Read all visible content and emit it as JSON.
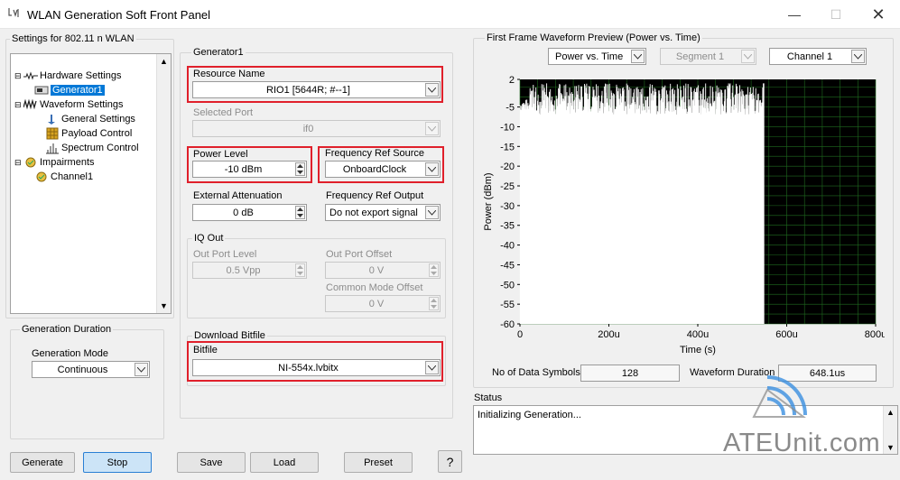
{
  "window": {
    "title": "WLAN Generation Soft Front Panel"
  },
  "settings_group": {
    "label": "Settings for 802.11 n WLAN"
  },
  "tree": {
    "hardware_settings": "Hardware Settings",
    "generator1": "Generator1",
    "waveform_settings": "Waveform Settings",
    "general_settings": "General Settings",
    "payload_control": "Payload Control",
    "spectrum_control": "Spectrum Control",
    "impairments": "Impairments",
    "channel1": "Channel1"
  },
  "generation_duration": {
    "label": "Generation Duration",
    "mode_label": "Generation Mode",
    "mode_value": "Continuous"
  },
  "generator1": {
    "label": "Generator1",
    "resource_name_label": "Resource Name",
    "resource_name_value": "RIO1 [5644R; #--1]",
    "selected_port_label": "Selected Port",
    "selected_port_value": "if0",
    "power_level_label": "Power Level",
    "power_level_value": "-10 dBm",
    "freq_ref_source_label": "Frequency Ref Source",
    "freq_ref_source_value": "OnboardClock",
    "ext_atten_label": "External Attenuation",
    "ext_atten_value": "0 dB",
    "freq_ref_output_label": "Frequency Ref Output",
    "freq_ref_output_value": "Do not export signal"
  },
  "iq_out": {
    "label": "IQ Out",
    "out_port_level_label": "Out Port Level",
    "out_port_level_value": "0.5 Vpp",
    "out_port_offset_label": "Out Port Offset",
    "out_port_offset_value": "0 V",
    "common_mode_offset_label": "Common Mode Offset",
    "common_mode_offset_value": "0 V"
  },
  "download_bitfile": {
    "label": "Download Bitfile",
    "bitfile_label": "Bitfile",
    "bitfile_value": "NI-554x.lvbitx"
  },
  "preview": {
    "label": "First Frame Waveform Preview (Power vs. Time)",
    "view_select": "Power vs. Time",
    "segment_select": "Segment 1",
    "channel_select": "Channel 1",
    "num_data_symbols_label": "No of Data Symbols",
    "num_data_symbols_value": "128",
    "waveform_duration_label": "Waveform Duration",
    "waveform_duration_value": "648.1us"
  },
  "status": {
    "label": "Status",
    "text": "Initializing Generation..."
  },
  "buttons": {
    "generate": "Generate",
    "stop": "Stop",
    "save": "Save",
    "load": "Load",
    "preset": "Preset",
    "help": "?"
  },
  "watermark": "ATEUnit.com",
  "chart_data": {
    "type": "line",
    "xlabel": "Time (s)",
    "ylabel": "Power (dBm)",
    "xlim": [
      0,
      800
    ],
    "ylim": [
      -60,
      2
    ],
    "x_ticks": [
      "0",
      "200u",
      "400u",
      "600u",
      "800u"
    ],
    "y_ticks": [
      "2",
      "-5",
      "-10",
      "-15",
      "-20",
      "-25",
      "-30",
      "-35",
      "-40",
      "-45",
      "-50",
      "-55",
      "-60"
    ],
    "grid": true,
    "series": [
      {
        "x_start": 0,
        "x_preamble_end": 22,
        "x_end": 548,
        "preamble_level": -6,
        "peak_level": 1,
        "floor_level": -60,
        "color": "#ffffff"
      }
    ]
  },
  "colors": {
    "red_highlight": "#e0202b",
    "selected_tree": "#0078d7",
    "plot_bg": "#000000",
    "grid": "#1f6b1f",
    "trace": "#ffffff"
  }
}
